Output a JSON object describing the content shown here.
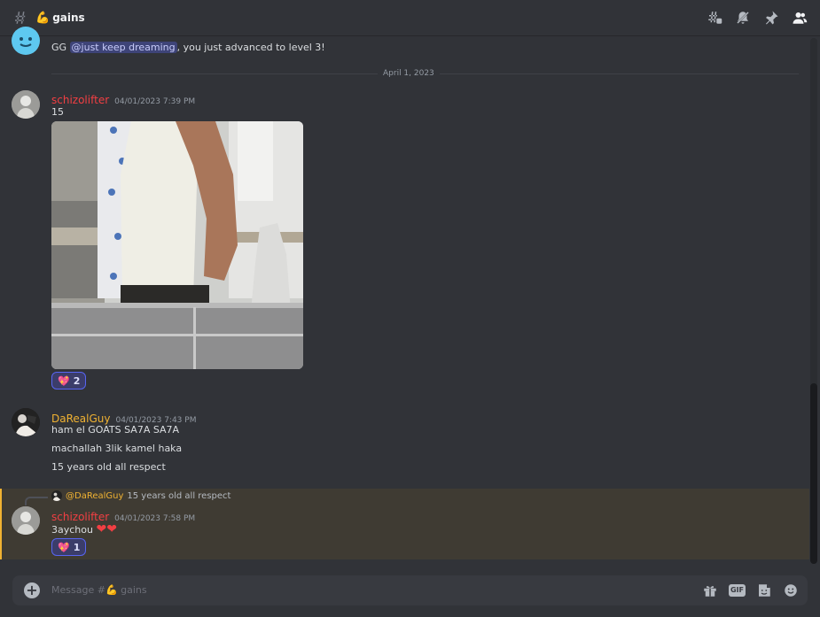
{
  "channel": {
    "emoji": "💪",
    "name": "gains"
  },
  "messages": {
    "levelup": {
      "text_before": "GG ",
      "mention": "@just keep dreaming",
      "text_after": ", you just advanced to level 3!"
    },
    "date_divider": "April 1, 2023",
    "m1": {
      "author": "schizolifter",
      "timestamp": "04/01/2023 7:39 PM",
      "text": "15",
      "reaction_count": "2"
    },
    "m2": {
      "author": "DaRealGuy",
      "timestamp": "04/01/2023 7:43 PM",
      "lines": [
        "ham el GOATS SA7A SA7A",
        "machallah 3lik kamel haka",
        "15 years old all respect"
      ]
    },
    "m3": {
      "reply_author": "@DaRealGuy",
      "reply_text": "15 years old all respect",
      "author": "schizolifter",
      "timestamp": "04/01/2023 7:58 PM",
      "text": "3aychou",
      "text_emoji": "❤❤",
      "reaction_count": "1"
    }
  },
  "composer": {
    "placeholder_prefix": "Message #",
    "placeholder_emoji": "💪",
    "placeholder_channel": " gains",
    "gif_label": "GIF"
  },
  "colors": {
    "schizolifter": "#f23f43",
    "darealguy": "#f0b232",
    "accent": "#5865f2"
  }
}
